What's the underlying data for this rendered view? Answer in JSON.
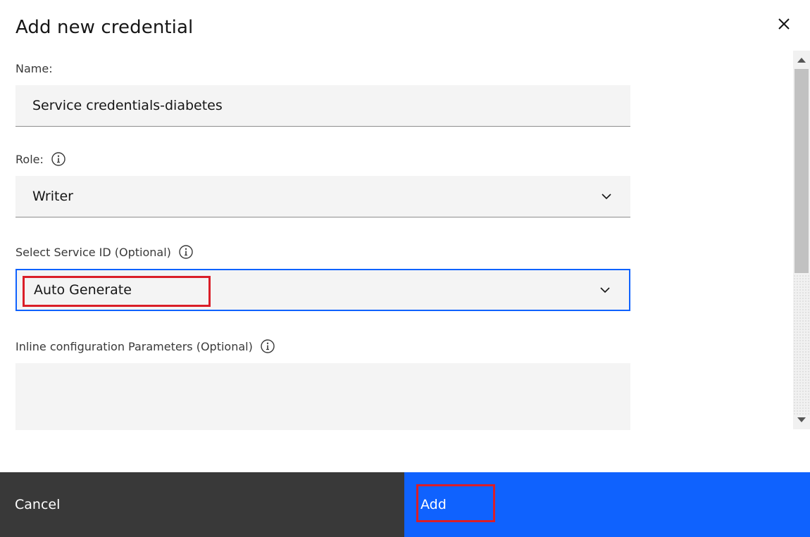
{
  "modal": {
    "title": "Add new credential",
    "close_icon": "close-icon"
  },
  "form": {
    "name": {
      "label": "Name:",
      "value": "Service credentials-diabetes"
    },
    "role": {
      "label": "Role:",
      "value": "Writer",
      "info_icon": "info-icon"
    },
    "service_id": {
      "label": "Select Service ID (Optional)",
      "value": "Auto Generate",
      "info_icon": "info-icon"
    },
    "inline_params": {
      "label": "Inline configuration Parameters (Optional)",
      "value": "",
      "info_icon": "info-icon"
    }
  },
  "footer": {
    "cancel_label": "Cancel",
    "add_label": "Add"
  },
  "colors": {
    "primary": "#0f62fe",
    "secondary": "#393939",
    "field_bg": "#f4f4f4",
    "highlight": "#da1e28"
  }
}
